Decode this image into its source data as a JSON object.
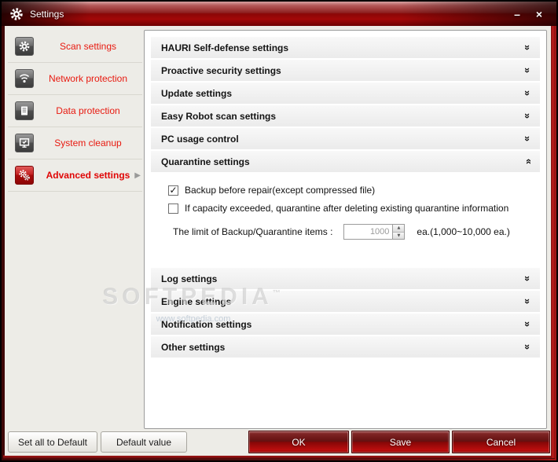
{
  "window": {
    "title": "Settings"
  },
  "titlebar": {
    "minimize_glyph": "–",
    "close_glyph": "×"
  },
  "icons": {
    "double_chevron": "»",
    "arrow_right": "▶",
    "spin_up": "▲",
    "spin_down": "▼"
  },
  "sidebar": {
    "items": [
      {
        "label": "Scan settings"
      },
      {
        "label": "Network protection"
      },
      {
        "label": "Data protection"
      },
      {
        "label": "System cleanup"
      },
      {
        "label": "Advanced settings",
        "active": true
      }
    ]
  },
  "accordion": {
    "sections": [
      {
        "label": "HAURI Self-defense settings",
        "expanded": false
      },
      {
        "label": "Proactive security settings",
        "expanded": false
      },
      {
        "label": "Update settings",
        "expanded": false
      },
      {
        "label": "Easy Robot scan settings",
        "expanded": false
      },
      {
        "label": "PC usage control",
        "expanded": false
      },
      {
        "label": "Quarantine settings",
        "expanded": true
      },
      {
        "label": "Log settings",
        "expanded": false
      },
      {
        "label": "Engine settings",
        "expanded": false
      },
      {
        "label": "Notification settings",
        "expanded": false
      },
      {
        "label": "Other settings",
        "expanded": false
      }
    ]
  },
  "quarantine": {
    "backup_checkbox": {
      "label": "Backup before repair(except compressed file)",
      "checked": true,
      "glyph": "✓"
    },
    "capacity_checkbox": {
      "label": "If capacity exceeded, quarantine after deleting existing quarantine information",
      "checked": false,
      "glyph": ""
    },
    "limit_label": "The limit of Backup/Quarantine items :",
    "limit_value": "1000",
    "limit_range": "ea.(1,000~10,000 ea.)"
  },
  "footer": {
    "set_all_default_label": "Set all to Default",
    "default_value_label": "Default value",
    "ok_label": "OK",
    "save_label": "Save",
    "cancel_label": "Cancel"
  },
  "watermark": {
    "title": "SOFTPEDIA",
    "tm": "™",
    "subtitle": "www.softpedia.com"
  },
  "colors": {
    "accent_red": "#c00000",
    "titlebar_red": "#8a0707",
    "sidebar_text_red": "#e8190f",
    "panel_bg": "#ffffff",
    "content_bg": "#edece7"
  }
}
